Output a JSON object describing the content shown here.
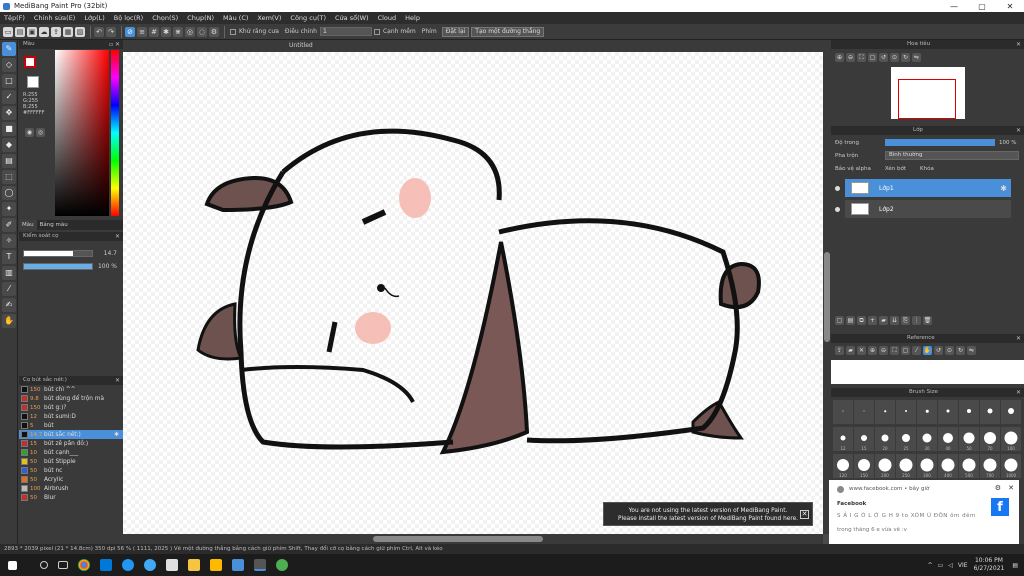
{
  "window": {
    "title": "MediBang Paint Pro (32bit)",
    "controls": [
      "—",
      "▢",
      "✕"
    ]
  },
  "menu": [
    "Tệp(F)",
    "Chỉnh sửa(E)",
    "Lớp(L)",
    "Bộ lọc(R)",
    "Chọn(S)",
    "Chụp(N)",
    "Màu (C)",
    "Xem(V)",
    "Công cụ(T)",
    "Cửa sổ(W)",
    "Cloud",
    "Help"
  ],
  "toolbar": {
    "antialias_label": "Khử răng cưa",
    "adjust_label": "Điều chỉnh",
    "adjust_value": "1",
    "correction_label": "Cạnh mềm",
    "fill_label": "Phím",
    "clear_label": "Đặt lại",
    "create_line_label": "Tạo một đường thẳng"
  },
  "color_panel": {
    "title": "Màu",
    "rgb": [
      "R:255",
      "G:255",
      "B:255"
    ],
    "hex": "#FFFFFF"
  },
  "tabs": {
    "color": "Màu",
    "palette": "Bảng màu"
  },
  "brush_control": {
    "title": "Kiểm soát cọ",
    "size": "14.7",
    "opacity": "100 %",
    "size_fraction": 0.72,
    "opacity_fraction": 1.0
  },
  "document": {
    "tab_title": "Untitled"
  },
  "notice": {
    "line1": "You are not using the latest version of MediBang Paint.",
    "line2": "Please install the latest version of MediBang Paint found here.",
    "close": "✕"
  },
  "brush_list": {
    "title": "Cọ bút sắc nét:)",
    "items": [
      {
        "size": "150",
        "name": "bút chì ^^",
        "color": "#111111"
      },
      {
        "size": "9.8",
        "name": "bút dùng để trộn mà",
        "color": "#c03030"
      },
      {
        "size": "150",
        "name": "bút g:)?",
        "color": "#c03030"
      },
      {
        "size": "12",
        "name": "bút sumi:D",
        "color": "#111111"
      },
      {
        "size": "5",
        "name": "bút",
        "color": "#111111"
      },
      {
        "size": "14.7",
        "name": "bút sắc nét:)",
        "color": "#111111",
        "selected": true
      },
      {
        "size": "15",
        "name": "bút zê pân đồ:)",
        "color": "#c03030"
      },
      {
        "size": "10",
        "name": "bút cạnh___",
        "color": "#30a030"
      },
      {
        "size": "50",
        "name": "bút Stipple",
        "color": "#e0c020"
      },
      {
        "size": "50",
        "name": "bút nc",
        "color": "#3060d0"
      },
      {
        "size": "50",
        "name": "Acrylic",
        "color": "#e07020"
      },
      {
        "size": "100",
        "name": "Airbrush",
        "color": "#bbbbbb"
      },
      {
        "size": "50",
        "name": "Blur",
        "color": "#c03030"
      }
    ]
  },
  "navigator": {
    "title": "Hoa tiêu"
  },
  "layer_panel": {
    "title": "Lớp",
    "opacity_label": "Độ trong",
    "opacity_value": "100 %",
    "blend_label": "Pha trộn",
    "blend_value": "Bình thường",
    "protect_alpha": "Bảo vệ alpha",
    "clipping": "Xén bớt",
    "lock": "Khóa",
    "layers": [
      {
        "name": "Lớp1",
        "selected": true
      },
      {
        "name": "Lớp2",
        "selected": false
      }
    ]
  },
  "reference": {
    "title": "Reference"
  },
  "brush_size": {
    "title": "Brush Size",
    "row1": [
      "",
      "",
      "",
      "",
      "",
      "",
      "",
      "",
      ""
    ],
    "row2": [
      "12",
      "15",
      "20",
      "25",
      "30",
      "40",
      "50",
      "70",
      "100"
    ],
    "row3": [
      "120",
      "150",
      "200",
      "250",
      "300",
      "400",
      "500",
      "700",
      "1000"
    ]
  },
  "toast": {
    "source": "www.facebook.com • bây giờ",
    "app": "Facebook",
    "text1": "S Ả I G Ò L Ớ G H 9 to XÓM Ú ĐÔN ôm đêm",
    "text2": "trong tháng 6 e vừa vẽ :v"
  },
  "status": {
    "text": "2893 * 2039 pixel  (21 * 14.8cm)  350 dpi  56 %  ( 1111, 2025 )  Vẽ một đường thẳng bằng cách giữ phím Shift, Thay đổi cỡ cọ bằng cách giữ phím Ctrl, Alt và kéo"
  },
  "taskbar": {
    "lang": "VIE",
    "time": "10:06 PM",
    "date": "6/27/2021"
  }
}
